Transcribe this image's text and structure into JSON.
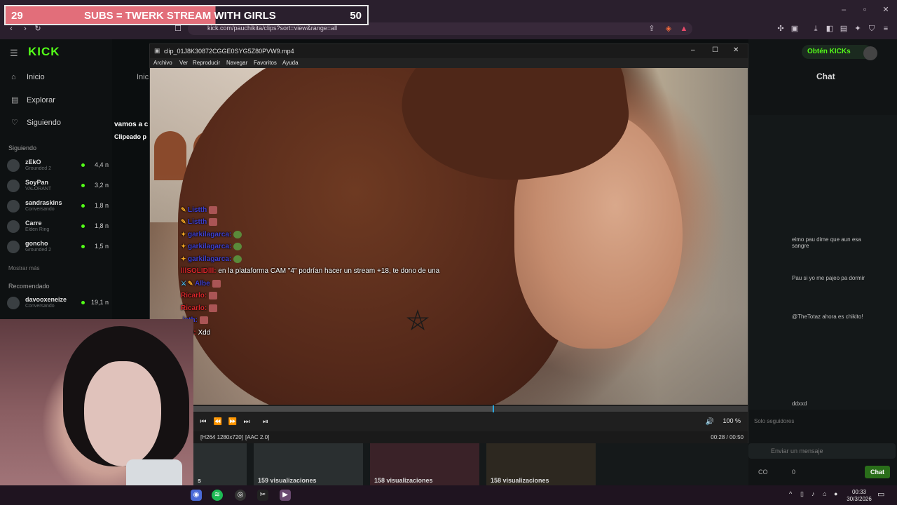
{
  "banner": {
    "left_num": "29",
    "title": "SUBS = TWERK STREAM WITH GIRLS",
    "right_num": "50"
  },
  "browser": {
    "url": "kick.com/pauchikita/clips?sort=view&range=all"
  },
  "kick": {
    "nav": [
      {
        "label": "Inicio"
      },
      {
        "label": "Explorar"
      },
      {
        "label": "Siguiendo"
      }
    ],
    "following_label": "Siguiendo",
    "channels": [
      {
        "name": "zEkO",
        "sub": "Grounded 2",
        "count": "4,4 n"
      },
      {
        "name": "SoyPan",
        "sub": "VALORANT",
        "count": "3,2 n"
      },
      {
        "name": "sandraskins",
        "sub": "Conversando",
        "count": "1,8 n"
      },
      {
        "name": "Carre",
        "sub": "Elden Ring",
        "count": "1,8 n"
      },
      {
        "name": "goncho",
        "sub": "Grounded 2",
        "count": "1,5 n"
      }
    ],
    "show_more": "Mostrar más",
    "recommended_label": "Recomendado",
    "recommended": [
      {
        "name": "davooxeneize",
        "sub": "Conversando",
        "count": "19,1 n"
      }
    ],
    "page_tab": "Inic",
    "clip_text": "vamos a c",
    "clipped_text": "Clipeado p",
    "get_kicks": "Obtén KICKs",
    "chat_title": "Chat",
    "chat_lines": [
      "eimo pau dime que aun esa sangre",
      "Pau si yo me pajeo pa dormir",
      "@TheTotaz ahora es chikito!",
      "ddxxd"
    ],
    "followers_only": "Solo seguidores",
    "send_placeholder": "Enviar un mensaje",
    "chat_button": "Chat",
    "cc_label": "CO",
    "zero": "0"
  },
  "player": {
    "title": "clip_01J8K30872CGGE0SYG5Z80PVW9.mp4",
    "menu": [
      "Archivo",
      "Ver",
      "Reproducir",
      "Navegar",
      "Favoritos",
      "Ayuda"
    ],
    "progress": 0.54,
    "volume": "100 %",
    "codec_video": "[H264 1280x720]",
    "codec_audio": "[AAC 2.0]",
    "time": "00:28 / 00:50"
  },
  "overlay_chat": [
    {
      "user": "Listth",
      "text": "",
      "color": "blue"
    },
    {
      "user": "Listth",
      "text": "",
      "color": "blue"
    },
    {
      "user": "garkilagarca:",
      "text": "",
      "color": "blue"
    },
    {
      "user": "garkilagarca:",
      "text": "",
      "color": "blue"
    },
    {
      "user": "garkilagarca:",
      "text": "",
      "color": "blue"
    },
    {
      "user": "lllSOLIDlll:",
      "text": "en la plataforma CAM \"4\" podrían hacer un stream +18, te dono de una",
      "color": "red"
    },
    {
      "user": "Albe",
      "text": "",
      "color": "blue"
    },
    {
      "user": "Ricarlo:",
      "text": "",
      "color": "red"
    },
    {
      "user": "Ricarlo:",
      "text": "",
      "color": "red"
    },
    {
      "user": ".isth:",
      "text": "",
      "color": "blue"
    },
    {
      "user": "arlo:",
      "text": "Xdd",
      "color": "red"
    }
  ],
  "thumbs": [
    {
      "label": "s"
    },
    {
      "label": "159 visualizaciones"
    },
    {
      "label": "158 visualizaciones"
    },
    {
      "label": "158 visualizaciones"
    }
  ],
  "taskbar": {
    "time": "00:33",
    "date": "30/3/2026"
  },
  "colors": {
    "kick_green": "#53fc18",
    "seek_accent": "#29a8e0",
    "banner_pink": "#e26e7a"
  }
}
